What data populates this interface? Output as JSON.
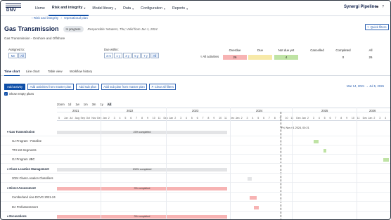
{
  "logo_text": "DNV",
  "nav": {
    "items": [
      {
        "label": "Home"
      },
      {
        "label": "Risk and integrity",
        "chevron": "▾"
      },
      {
        "label": "Model library",
        "chevron": "▾"
      },
      {
        "label": "Data",
        "chevron": "▾"
      },
      {
        "label": "Configuration",
        "chevron": "▾"
      },
      {
        "label": "Reports",
        "chevron": "▾"
      }
    ],
    "brand": "Synergi Pipeline",
    "icons": [
      "user-icon",
      "help-icon"
    ]
  },
  "breadcrumb": [
    "‹ Risk and integrity",
    "›",
    "Operational plan"
  ],
  "page": {
    "title": "Gas Transmission",
    "status": "In progress",
    "responsible": "Responsible: Wouters, Thu; Valid from Jan 1, 2024",
    "quick_filters": "Quick filters",
    "subtitle": "Gas Transmission - Onshore and Offshore"
  },
  "filters": {
    "assigned_label": "Assigned to:",
    "assigned_options": [
      "Me",
      "All"
    ],
    "due_label": "Due within:",
    "due_options": [
      "3 m",
      "1 y",
      "3 y",
      "5 y",
      "7 y",
      "All"
    ],
    "all_activities": "All activities",
    "summary": [
      {
        "label": "Overdue",
        "value": "26",
        "color": "#f7b3b3"
      },
      {
        "label": "Due",
        "value": "",
        "color": "#f7e9a8"
      },
      {
        "label": "Not due yet",
        "value": "4",
        "color": "#bfe3a4"
      },
      {
        "label": "Cancelled",
        "value": "",
        "color": "#ffffff"
      },
      {
        "label": "Completed",
        "value": "0",
        "color": "#ffffff"
      },
      {
        "label": "All",
        "value": "26",
        "color": "#ffffff"
      }
    ]
  },
  "tabs": [
    "Time chart",
    "Line chart",
    "Table view",
    "Workflow history"
  ],
  "actions": {
    "buttons": [
      "Add activity",
      "Add activities from master plan",
      "Add sub plan",
      "Add sub plan from master plan",
      "✕ Clear all filters"
    ],
    "show_empty": "Show empty plans",
    "date_range": "Mar 14, 2021 → Jul 5, 2026"
  },
  "zoom": {
    "label": "Zoom",
    "options": [
      "1d",
      "1w",
      "1m",
      "3m",
      "1y",
      "All"
    ],
    "selected": "All"
  },
  "timeline": {
    "years": [
      "2021",
      "2022",
      "2023",
      "2024",
      "2025",
      "2026"
    ],
    "months": [
      "5",
      "Jun",
      "Jul",
      "Aug",
      "Sep",
      "Oct",
      "Nov",
      "Dec",
      "Jan",
      "2",
      "3",
      "4",
      "5",
      "6",
      "7",
      "8",
      "9",
      "10",
      "11",
      "Dec",
      "Jan",
      "2",
      "3",
      "4",
      "5",
      "6",
      "7",
      "8",
      "9",
      "10",
      "11",
      "Dec",
      "Jan",
      "2",
      "3",
      "4",
      "5",
      "6",
      "7",
      "8",
      "9",
      "10",
      "11",
      "Dec",
      "Jan",
      "2",
      "3",
      "4",
      "5",
      "6",
      "7",
      "8",
      "9",
      "10",
      "11",
      "Dec",
      "Jan",
      "2",
      "3",
      "4"
    ],
    "today": "Fri, Nov 01 2024, 00:21",
    "rows": [
      {
        "label": "Gas Transmission",
        "group": true,
        "bar": {
          "text": "23% completed",
          "color": "#e3e4e6"
        }
      },
      {
        "label": "GJ Program - Passline",
        "group": false,
        "bar": {
          "text": "",
          "color": "#bfe3a4"
        }
      },
      {
        "label": "TRI 116 Segments",
        "group": false,
        "bar": {
          "text": "",
          "color": "#bfe3a4"
        }
      },
      {
        "label": "GJ Program UBC",
        "group": false,
        "bar": {
          "text": "",
          "color": "#bfe3a4"
        }
      },
      {
        "label": "Class Location Management",
        "group": true,
        "bar": {
          "text": "100% completed",
          "color": "#e3e4e6"
        }
      },
      {
        "label": "2024 Class Location Classifiers",
        "group": false,
        "bar": {
          "text": "",
          "color": "#e3e4e6"
        }
      },
      {
        "label": "Direct Assessment",
        "group": true,
        "bar": {
          "text": "0% completed",
          "color": "#f7b3b3"
        }
      },
      {
        "label": "Cumberland Line DCVG 2021-24",
        "group": false,
        "bar": {
          "text": "",
          "color": "#f7b3b3"
        }
      },
      {
        "label": "DA Prefassessment",
        "group": false,
        "bar": {
          "text": "",
          "color": "#f7b3b3"
        }
      },
      {
        "label": "Excavations",
        "group": true,
        "bar": {
          "text": "0% completed",
          "color": "#f7b3b3"
        }
      }
    ]
  }
}
